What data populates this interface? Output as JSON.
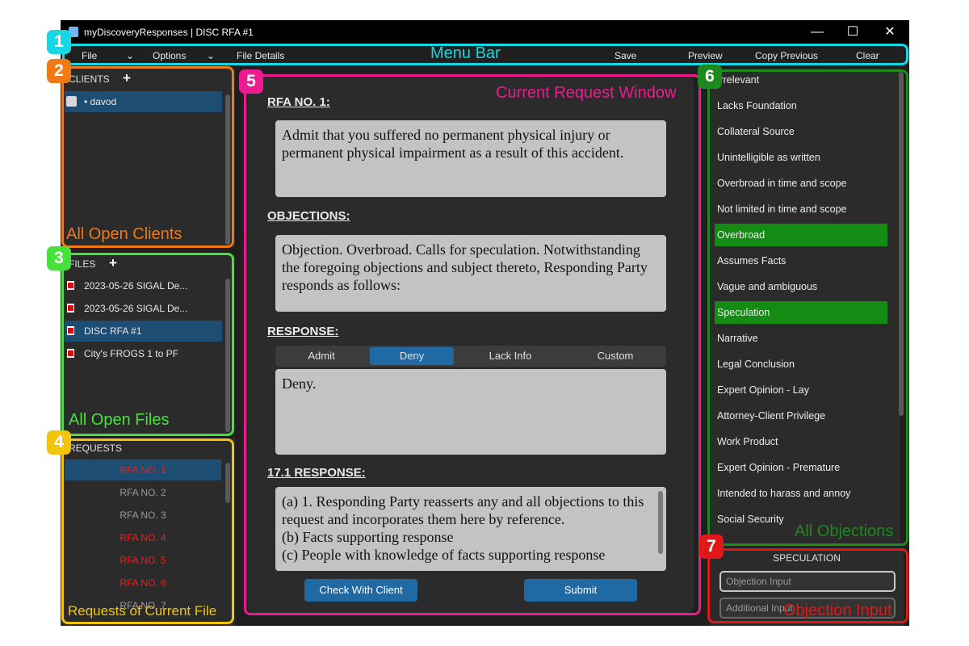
{
  "window": {
    "title": "myDiscoveryResponses  |  DISC RFA #1",
    "controls": {
      "minimize": "—",
      "maximize": "☐",
      "close": "✕"
    }
  },
  "menu": {
    "file": "File",
    "options": "Options",
    "file_details": "File Details",
    "save": "Save",
    "preview": "Preview",
    "copy_previous": "Copy Previous",
    "clear": "Clear"
  },
  "clients": {
    "header": "CLIENTS",
    "add": "+",
    "items": [
      "• davod"
    ]
  },
  "files": {
    "header": "FILES",
    "add": "+",
    "items": [
      "2023-05-26 SIGAL De...",
      "2023-05-26 SIGAL De...",
      "DISC RFA #1",
      "City's FROGS 1 to PF"
    ]
  },
  "requests": {
    "header": "REQUESTS",
    "items": [
      "RFA NO. 1",
      "RFA NO. 2",
      "RFA NO. 3",
      "RFA NO. 4",
      "RFA NO. 5",
      "RFA NO. 6",
      "RFA NO. 7"
    ]
  },
  "current": {
    "request_title": "RFA NO. 1:",
    "request_text": "Admit that you suffered no permanent physical injury or permanent physical impairment as a result of this accident.",
    "objections_title": "OBJECTIONS:",
    "objections_text": "Objection. Overbroad. Calls for speculation. Notwithstanding the foregoing objections and subject thereto, Responding Party responds as follows:",
    "response_title": "RESPONSE:",
    "response_options": [
      "Admit",
      "Deny",
      "Lack Info",
      "Custom"
    ],
    "response_text": "Deny.",
    "resp171_title": "17.1 RESPONSE:",
    "resp171_text": "(a) 1. Responding Party reasserts any and all objections to this request and incorporates them here by reference.\n(b) Facts supporting response\n(c) People with knowledge of facts supporting response",
    "check_client": "Check With Client",
    "submit": "Submit"
  },
  "objections": {
    "items": [
      "Irrelevant",
      "Lacks Foundation",
      "Collateral Source",
      "Unintelligible as written",
      "Overbroad in time and scope",
      "Not limited in time and scope",
      "Overbroad",
      "Assumes Facts",
      "Vague and ambiguous",
      "Speculation",
      "Narrative",
      "Legal Conclusion",
      "Expert Opinion - Lay",
      "Attorney-Client Privilege",
      "Work Product",
      "Expert Opinion - Premature",
      "Intended to harass and annoy",
      "Social Security"
    ],
    "selected": [
      "Overbroad",
      "Speculation"
    ]
  },
  "objection_input": {
    "header": "SPECULATION",
    "placeholder1": "Objection Input",
    "placeholder2": "Additional Input"
  },
  "annotations": {
    "menu_bar": "Menu Bar",
    "clients": "All Open Clients",
    "files": "All Open Files",
    "requests": "Requests of Current File",
    "current": "Current Request Window",
    "objections": "All Objections",
    "objection_input": "Objection Input",
    "badges": [
      "1",
      "2",
      "3",
      "4",
      "5",
      "6",
      "7"
    ]
  },
  "colors": {
    "cyan": "#19d6e3",
    "orange": "#f07a16",
    "green": "#46e23a",
    "yellow": "#f2c40b",
    "pink": "#ec1b8f",
    "darkgreen": "#1e8a1e",
    "red": "#e01818",
    "selection": "#1e4d73",
    "accent_blue": "#1f6aa5",
    "objection_selected": "#148c14"
  }
}
